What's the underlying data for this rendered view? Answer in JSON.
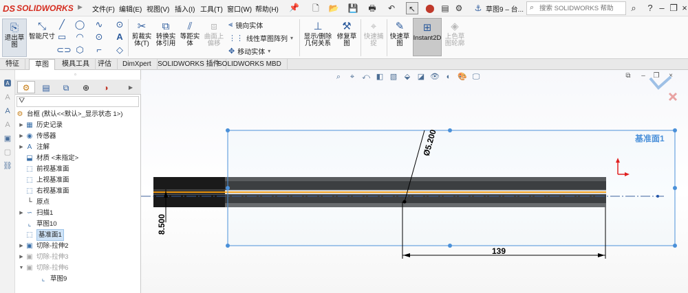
{
  "app": {
    "logo_prefix": "DS",
    "logo_text": "SOLIDWORKS",
    "document_title": "草图9 – 台...",
    "search_placeholder": "搜索 SOLIDWORKS 帮助"
  },
  "menu": [
    "文件(F)",
    "编辑(E)",
    "视图(V)",
    "插入(I)",
    "工具(T)",
    "窗口(W)",
    "帮助(H)"
  ],
  "ribbon": {
    "exit_sketch": "退出草图",
    "smart_dimension": "智能尺寸",
    "trim_entities": "剪裁实体(T)",
    "convert_entities": "转换实体引用",
    "offset_entities": "等距实体",
    "offset_surface": "曲面上偏移",
    "mirror_entities": "镜向实体",
    "linear_pattern": "线性草图阵列",
    "move_entities": "移动实体",
    "display_relations": "显示/删除几何关系",
    "repair_sketch": "修复草图",
    "quick_snaps": "快速捕捉",
    "rapid_sketch": "快速草图",
    "instant2d": "Instant2D",
    "shaded_sketch": "上色草图轮廓"
  },
  "tabs": [
    "特征",
    "草图",
    "模具工具",
    "评估",
    "DimXpert",
    "SOLIDWORKS 插件",
    "SOLIDWORKS MBD"
  ],
  "active_tab": "草图",
  "tree": {
    "root": "台框 (默认<<默认>_显示状态 1>)",
    "items": [
      {
        "label": "历史记录"
      },
      {
        "label": "传感器"
      },
      {
        "label": "注解"
      },
      {
        "label": "材质 <未指定>"
      },
      {
        "label": "前视基准面"
      },
      {
        "label": "上视基准面"
      },
      {
        "label": "右视基准面"
      },
      {
        "label": "原点"
      },
      {
        "label": "扫描1"
      },
      {
        "label": "草图10"
      },
      {
        "label": "基准面1"
      },
      {
        "label": "切除-拉伸2"
      },
      {
        "label": "切除-拉伸3"
      },
      {
        "label": "切除-拉伸6"
      },
      {
        "label": "草图9"
      }
    ]
  },
  "viewport": {
    "plane_label": "基准面1",
    "dim_diameter": "Ø5.200",
    "dim_height": "8.500",
    "dim_length": "139"
  },
  "colors": {
    "plane_outline": "#4a90d9",
    "part_dark": "#3a3a3a",
    "centerline_orange": "#f39c12",
    "logo_red": "#d52b1e"
  }
}
